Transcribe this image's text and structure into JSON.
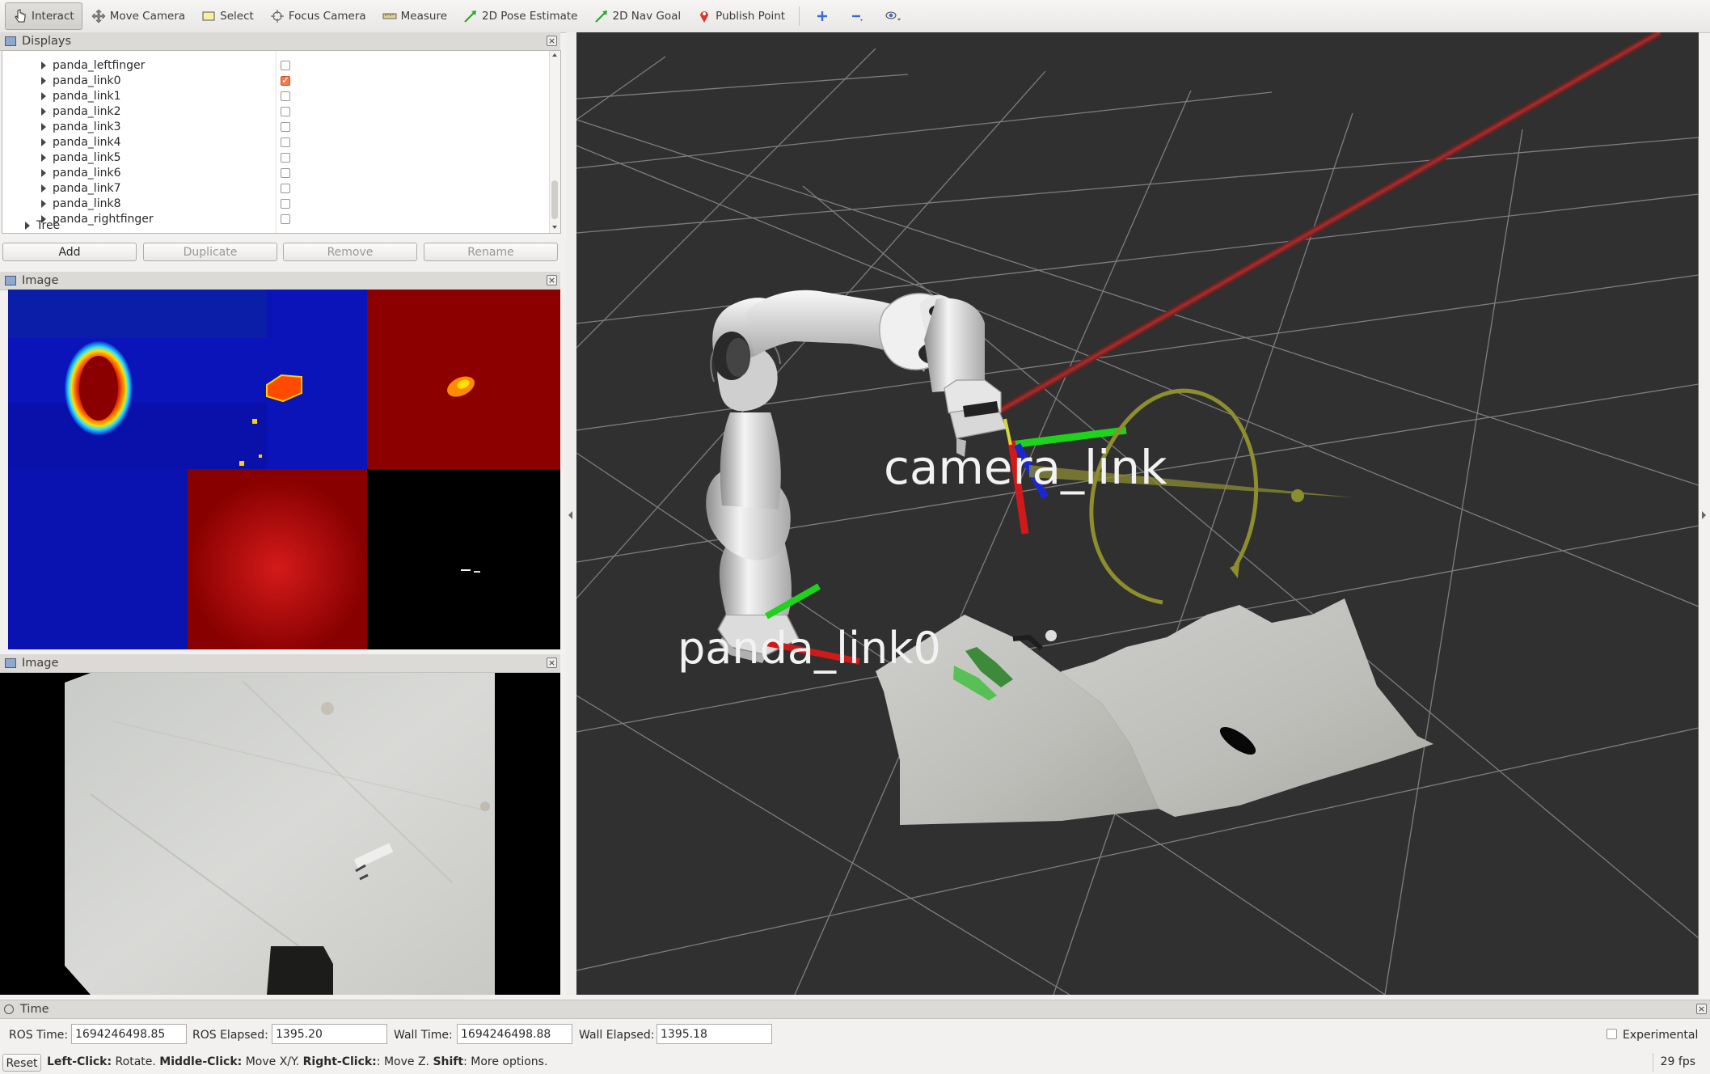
{
  "toolbar": {
    "tools": [
      {
        "label": "Interact",
        "icon": "hand-pointer-icon"
      },
      {
        "label": "Move Camera",
        "icon": "move-camera-icon"
      },
      {
        "label": "Select",
        "icon": "select-rectangle-icon"
      },
      {
        "label": "Focus Camera",
        "icon": "focus-camera-icon"
      },
      {
        "label": "Measure",
        "icon": "ruler-icon"
      },
      {
        "label": "2D Pose Estimate",
        "icon": "green-arrow-icon"
      },
      {
        "label": "2D Nav Goal",
        "icon": "green-arrow-icon"
      },
      {
        "label": "Publish Point",
        "icon": "map-pin-icon"
      }
    ],
    "active_tool": "Interact",
    "extra_icons": [
      "add-tool-icon",
      "remove-tool-icon",
      "view-options-icon"
    ]
  },
  "displays": {
    "title": "Displays",
    "items": [
      {
        "label": "panda_leftfinger",
        "checked": false
      },
      {
        "label": "panda_link0",
        "checked": true
      },
      {
        "label": "panda_link1",
        "checked": false
      },
      {
        "label": "panda_link2",
        "checked": false
      },
      {
        "label": "panda_link3",
        "checked": false
      },
      {
        "label": "panda_link4",
        "checked": false
      },
      {
        "label": "panda_link5",
        "checked": false
      },
      {
        "label": "panda_link6",
        "checked": false
      },
      {
        "label": "panda_link7",
        "checked": false
      },
      {
        "label": "panda_link8",
        "checked": false
      },
      {
        "label": "panda_rightfinger",
        "checked": false
      }
    ],
    "tree_label": "Tree",
    "buttons": {
      "add": "Add",
      "duplicate": "Duplicate",
      "remove": "Remove",
      "rename": "Rename"
    }
  },
  "image_panel_1": {
    "title": "Image"
  },
  "image_panel_2": {
    "title": "Image"
  },
  "view3d": {
    "labels": {
      "camera_link": "camera_link",
      "panda_link0": "panda_link0"
    },
    "colors": {
      "background": "#303030",
      "grid": "#8a8a8a",
      "x_axis": "#d01a1a",
      "y_axis": "#1ed21e",
      "z_axis": "#1a28d0",
      "circle": "#9a9a2a"
    }
  },
  "time": {
    "title": "Time",
    "ros_time_label": "ROS Time:",
    "ros_time": "1694246498.85",
    "ros_elapsed_label": "ROS Elapsed:",
    "ros_elapsed": "1395.20",
    "wall_time_label": "Wall Time:",
    "wall_time": "1694246498.88",
    "wall_elapsed_label": "Wall Elapsed:",
    "wall_elapsed": "1395.18",
    "experimental_label": "Experimental"
  },
  "status": {
    "reset": "Reset",
    "hint_left_click": "Left-Click:",
    "hint_left_text": " Rotate. ",
    "hint_middle_click": "Middle-Click:",
    "hint_middle_text": " Move X/Y. ",
    "hint_right_click": "Right-Click:",
    "hint_right_text": ": Move Z. ",
    "hint_shift": "Shift",
    "hint_shift_text": ": More options.",
    "fps": "29 fps"
  }
}
